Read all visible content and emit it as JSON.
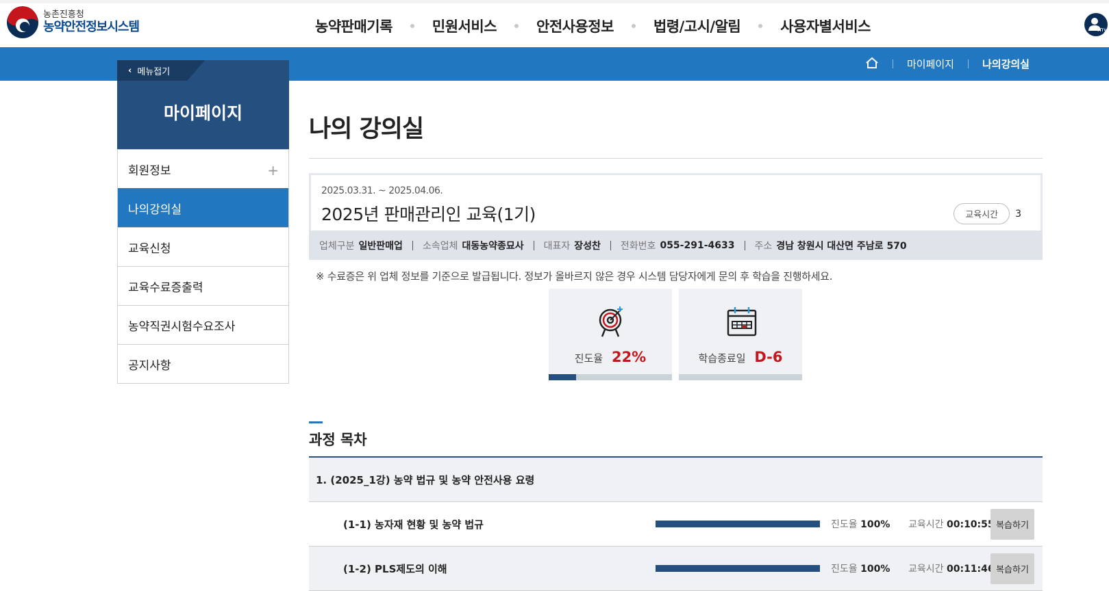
{
  "header": {
    "logo_sub": "농촌진흥청",
    "logo_main": "농약안전정보시스템",
    "nav": [
      "농약판매기록",
      "민원서비스",
      "안전사용정보",
      "법령/고시/알림",
      "사용자별서비스"
    ],
    "my_label": "my"
  },
  "breadcrumb": {
    "home_icon": "home-icon",
    "mypage": "마이페이지",
    "current": "나의강의실"
  },
  "sidebar": {
    "fold_label": "메뉴접기",
    "title": "마이페이지",
    "items": [
      {
        "label": "회원정보",
        "expandable": true
      },
      {
        "label": "나의강의실",
        "active": true
      },
      {
        "label": "교육신청"
      },
      {
        "label": "교육수료증출력"
      },
      {
        "label": "농약직권시험수요조사"
      },
      {
        "label": "공지사항"
      }
    ]
  },
  "main": {
    "page_title": "나의 강의실",
    "course": {
      "period": "2025.03.31. ~ 2025.04.06.",
      "name": "2025년 판매관리인 교육(1기)",
      "edu_time_label": "교육시간",
      "edu_time_value": "3",
      "info": [
        {
          "label": "업체구분",
          "value": "일반판매업"
        },
        {
          "label": "소속업체",
          "value": "대동농약종묘사"
        },
        {
          "label": "대표자",
          "value": "장성찬"
        },
        {
          "label": "전화번호",
          "value": "055-291-4633"
        },
        {
          "label": "주소",
          "value": "경남 창원시 대산면 주남로 570"
        }
      ]
    },
    "notice": "※ 수료증은 위 업체 정보를 기준으로 발급됩니다. 정보가 올바르지 않은 경우 시스템 담당자에게 문의 후 학습을 진행하세요.",
    "stats": {
      "progress_label": "진도율",
      "progress_value": "22%",
      "progress_fraction": 0.22,
      "end_label": "학습종료일",
      "end_value": "D-6",
      "end_fraction": 0.0
    },
    "toc": {
      "title": "과정 목차",
      "chapter": "1. (2025_1강) 농약 법규 및 농약 안전사용 요령",
      "lessons": [
        {
          "name": "(1-1) 농자재 현황 및 농약 법규",
          "rate_label": "진도율",
          "rate": "100%",
          "time_label": "교육시간",
          "time": "00:10:55",
          "button": "복습하기",
          "fraction": 1.0
        },
        {
          "name": "(1-2) PLS제도의 이해",
          "rate_label": "진도율",
          "rate": "100%",
          "time_label": "교육시간",
          "time": "00:11:46",
          "button": "복습하기",
          "fraction": 1.0
        }
      ]
    }
  },
  "colors": {
    "primary_blue": "#2178c0",
    "navy": "#244f7e",
    "accent_red": "#c4161c"
  }
}
